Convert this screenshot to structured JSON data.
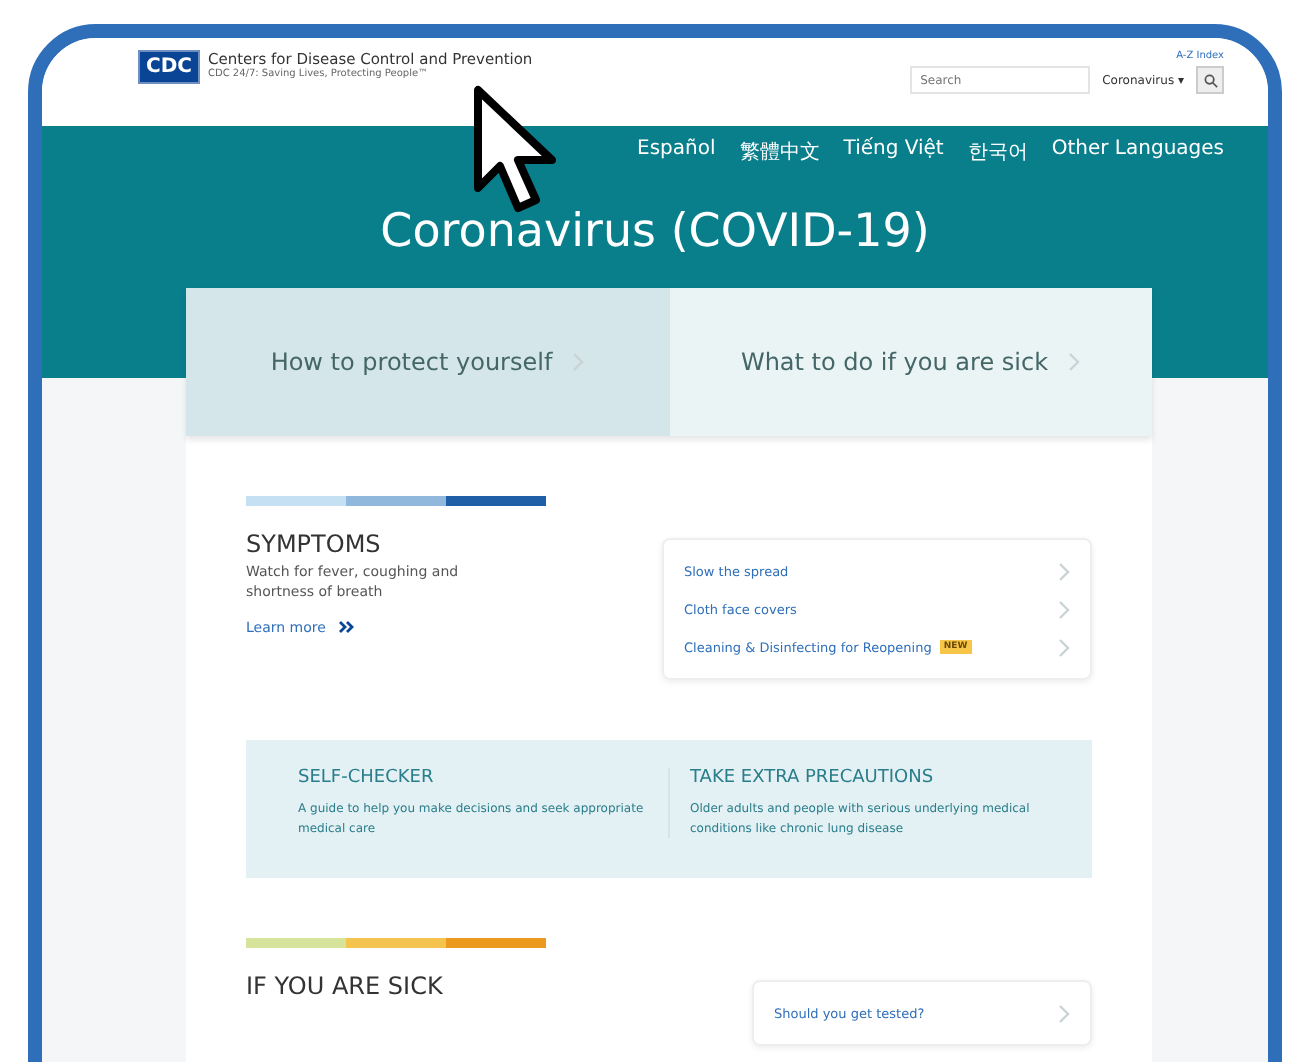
{
  "header": {
    "logo": "CDC",
    "org_name": "Centers for Disease Control and Prevention",
    "tagline": "CDC 24/7: Saving Lives, Protecting People™",
    "index_link": "A-Z Index",
    "search": {
      "placeholder": "Search"
    },
    "scope": "Coronavirus ▾"
  },
  "languages": [
    "Español",
    "繁體中文",
    "Tiếng Việt",
    "한국어",
    "Other Languages"
  ],
  "title": "Coronavirus (COVID-19)",
  "tabs": [
    {
      "label": "How to protect yourself",
      "selected": true
    },
    {
      "label": "What to do if you are sick",
      "selected": false
    }
  ],
  "symptoms": {
    "heading": "SYMPTOMS",
    "text": "Watch for fever, coughing and shortness of breath",
    "link": "Learn more"
  },
  "links": [
    {
      "label": "Slow the spread"
    },
    {
      "label": "Cloth face covers"
    },
    {
      "label": "Cleaning & Disinfecting for Reopening",
      "badge": "NEW"
    }
  ],
  "panels": [
    {
      "heading": "SELF-CHECKER",
      "text": "A guide to help you make decisions and seek appropriate medical care"
    },
    {
      "heading": "TAKE EXTRA PRECAUTIONS",
      "text": "Older adults and people with serious underlying medical conditions like chronic lung disease"
    }
  ],
  "sick": {
    "heading": "IF YOU ARE SICK",
    "link": "Should you get tested?"
  }
}
